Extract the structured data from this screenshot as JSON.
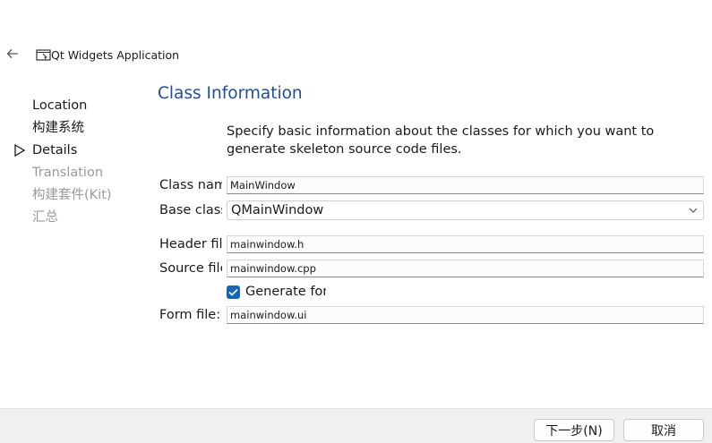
{
  "header": {
    "title": "Qt Widgets Application"
  },
  "icons": {
    "back": "arrow-left-icon",
    "app": "window-icon",
    "current_step": "triangle-right-icon",
    "dropdown": "chevron-down-icon",
    "check": "checkmark-icon"
  },
  "sidebar": {
    "steps": [
      {
        "label": "Location",
        "state": "done"
      },
      {
        "label": "构建系统",
        "state": "done"
      },
      {
        "label": "Details",
        "state": "active"
      },
      {
        "label": "Translation",
        "state": "pending"
      },
      {
        "label": "构建套件(Kit)",
        "state": "pending"
      },
      {
        "label": "汇总",
        "state": "pending"
      }
    ]
  },
  "main": {
    "title": "Class Information",
    "description": "Specify basic information about the classes for which you want to generate skeleton source code files.",
    "fields": {
      "class_name": {
        "label": "Class name:",
        "value": "MainWindow"
      },
      "base_class": {
        "label": "Base class:",
        "value": "QMainWindow"
      },
      "header_file": {
        "label": "Header file:",
        "value": "mainwindow.h"
      },
      "source_file": {
        "label": "Source file:",
        "value": "mainwindow.cpp"
      },
      "generate_form": {
        "label": "Generate form",
        "checked": true
      },
      "form_file": {
        "label": "Form file:",
        "value": "mainwindow.ui"
      }
    }
  },
  "footer": {
    "next_label": "下一步(N)",
    "cancel_label": "取消"
  },
  "colors": {
    "title": "#1f4e9c",
    "checkbox": "#1464c0",
    "pending_step": "#9a9a9a",
    "footer_bg": "#f0f0f0"
  }
}
